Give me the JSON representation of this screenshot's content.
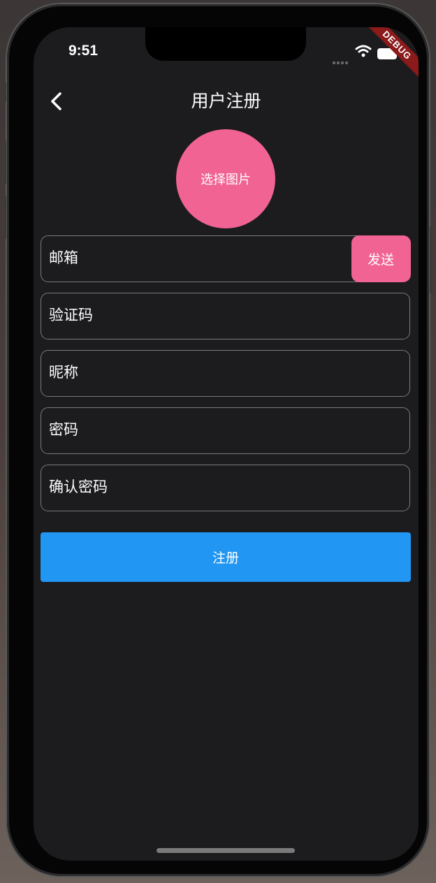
{
  "status_bar": {
    "time": "9:51"
  },
  "debug_banner": {
    "label": "DEBUG"
  },
  "header": {
    "title": "用户注册"
  },
  "avatar": {
    "label": "选择图片"
  },
  "form": {
    "email_label": "邮箱",
    "send_label": "发送",
    "code_label": "验证码",
    "nickname_label": "昵称",
    "password_label": "密码",
    "confirm_password_label": "确认密码"
  },
  "submit": {
    "label": "注册"
  },
  "colors": {
    "background": "#1c1b1e",
    "accent_pink": "#f06392",
    "primary_blue": "#2196f3",
    "field_border": "#7a7a7d",
    "debug_red": "#8b1a1a"
  }
}
